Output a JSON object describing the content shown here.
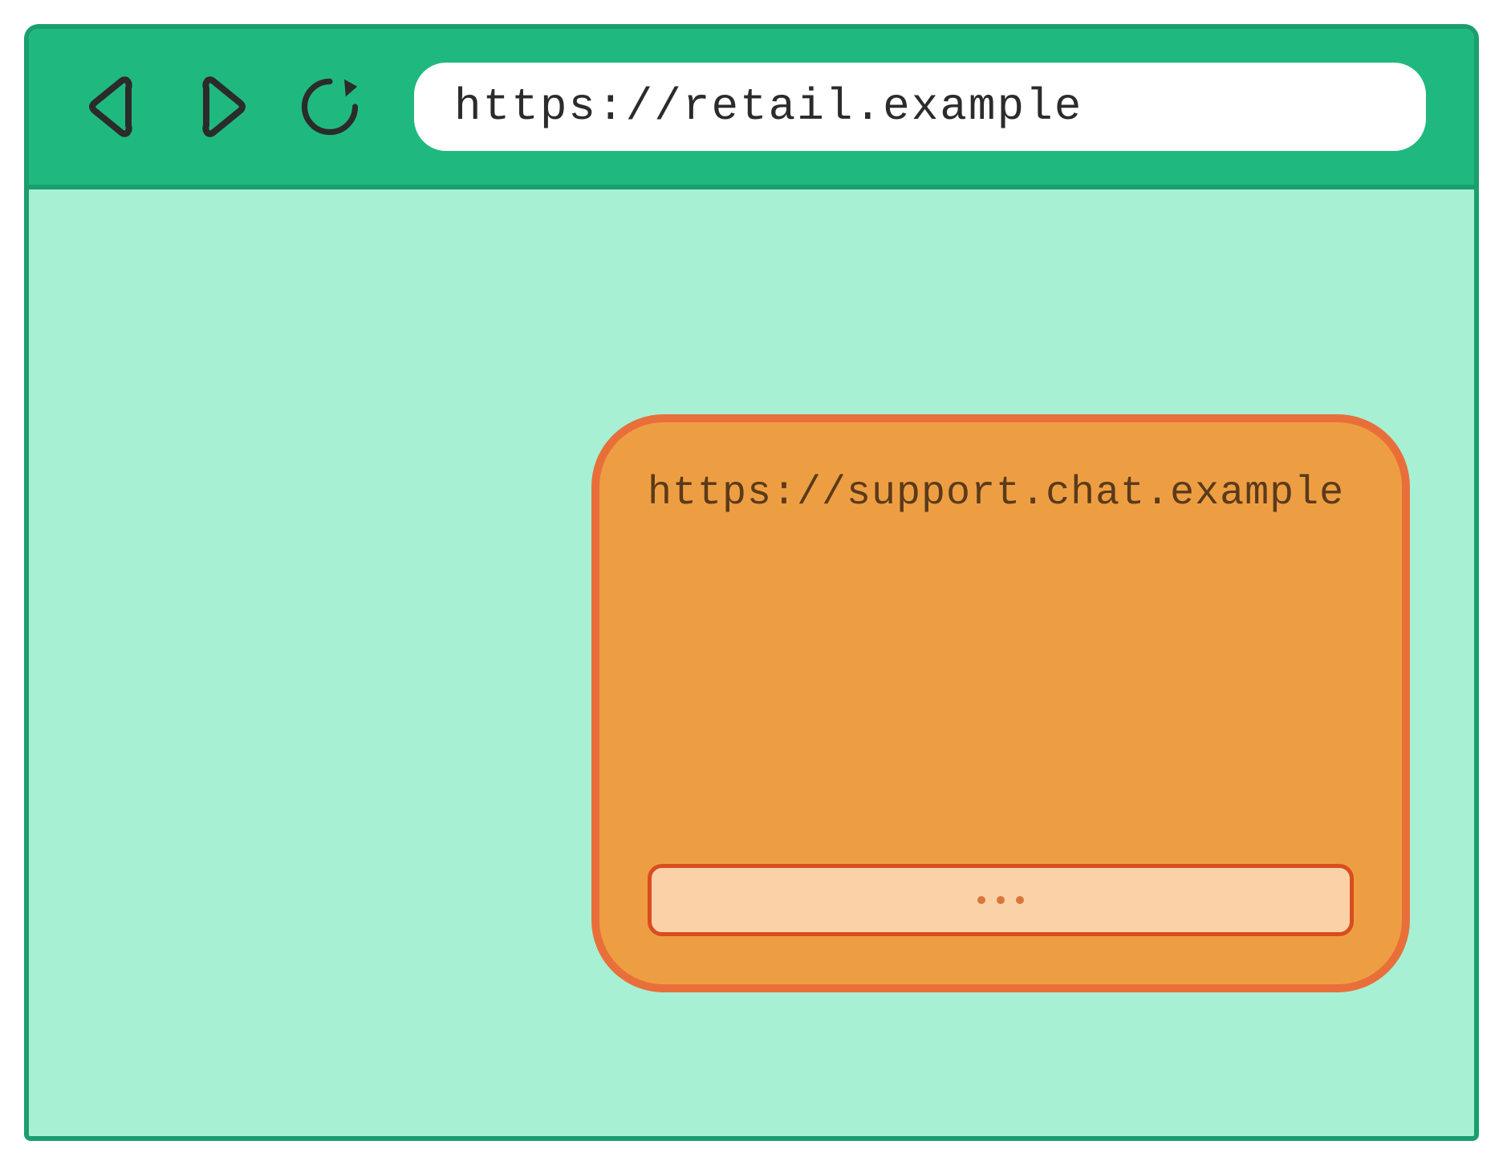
{
  "browser": {
    "url": "https://retail.example"
  },
  "widget": {
    "url": "https://support.chat.example"
  }
}
